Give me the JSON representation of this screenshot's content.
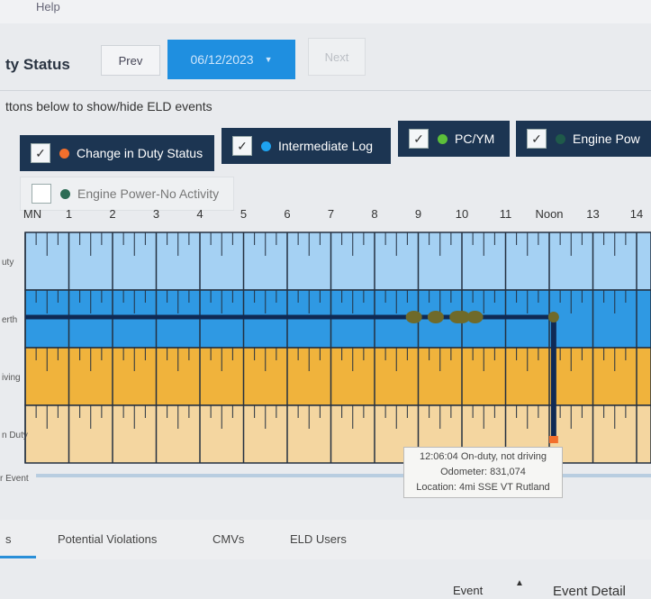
{
  "top": {
    "help": "Help"
  },
  "header": {
    "title": "ty Status",
    "prev": "Prev",
    "date": "06/12/2023",
    "next": "Next"
  },
  "hint": "ttons below to show/hide ELD events",
  "toggles": [
    {
      "label": "Change in Duty Status",
      "checked": true,
      "dot": "#f26f2c"
    },
    {
      "label": "Intermediate Log",
      "checked": true,
      "dot": "#1ea3f0"
    },
    {
      "label": "PC/YM",
      "checked": true,
      "dot": "#5cbf3a"
    },
    {
      "label": "Engine Pow",
      "checked": true,
      "dot": "#1f5a4a"
    },
    {
      "label": "Engine Power-No Activity",
      "checked": false,
      "dot": "#2c6c55"
    }
  ],
  "grid": {
    "hours": [
      "MN",
      "1",
      "2",
      "3",
      "4",
      "5",
      "6",
      "7",
      "8",
      "9",
      "10",
      "11",
      "Noon",
      "13",
      "14"
    ],
    "rows": [
      {
        "label": "uty",
        "color": "#a5d1f3"
      },
      {
        "label": "erth",
        "color": "#2f99e3"
      },
      {
        "label": "iving",
        "color": "#f0b33c"
      },
      {
        "label": "n Duty",
        "color": "#f4d6a0"
      }
    ],
    "event_row_label": "r Event",
    "log_line_hours": [
      0,
      12.1
    ],
    "markers_hours": [
      8.9,
      9.4,
      9.9,
      10.0,
      10.3
    ],
    "marker_color": "#6f6a2a",
    "transition_hour": 12.1
  },
  "tooltip": {
    "line1": "12:06:04 On-duty, not driving",
    "line2": "Odometer: 831,074",
    "line3": "Location: 4mi SSE VT Rutland"
  },
  "tabs": [
    "s",
    "Potential Violations",
    "CMVs",
    "ELD Users"
  ],
  "table": {
    "col_event": "Event",
    "col_detail": "Event Detail"
  }
}
